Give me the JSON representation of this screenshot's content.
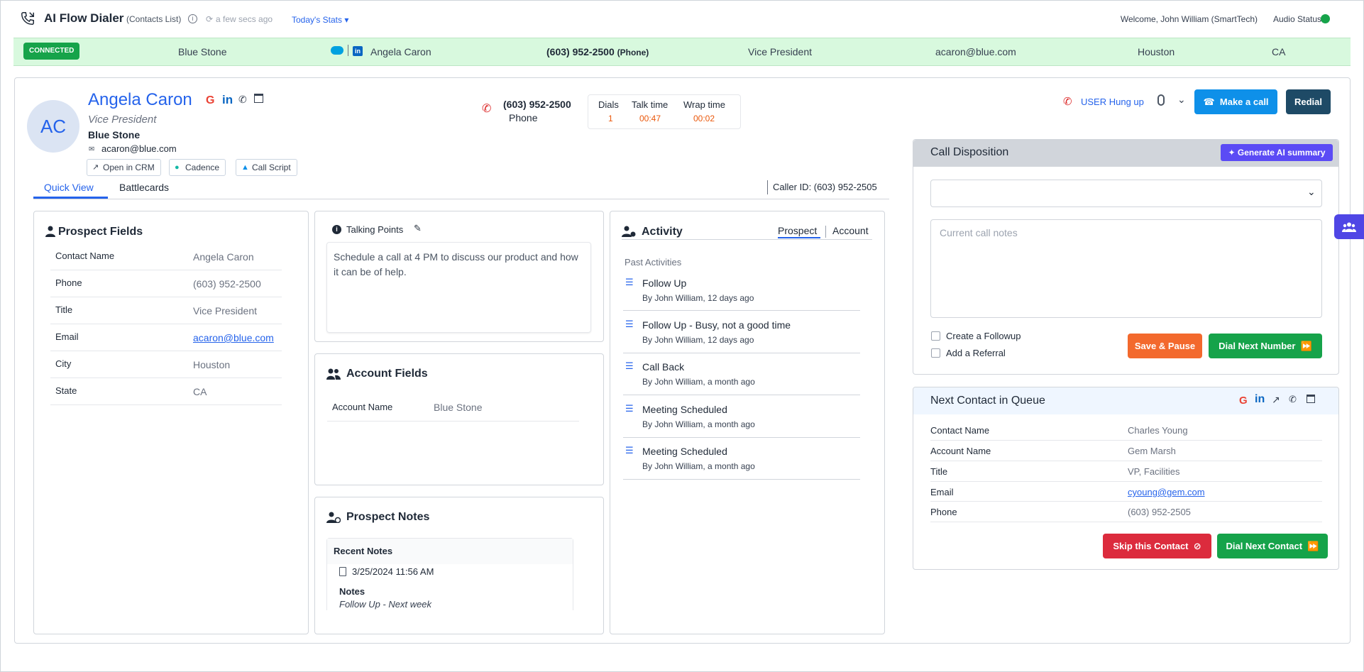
{
  "header": {
    "app_title": "AI Flow Dialer",
    "contacts_list": "(Contacts List)",
    "sync_text": "a few secs ago",
    "stats_link": "Today's Stats ▾",
    "welcome": "Welcome, John William (SmartTech)",
    "audio_status": "Audio Status"
  },
  "strip": {
    "badge": "CONNECTED",
    "company": "Blue Stone",
    "name": "Angela Caron",
    "phone": "(603) 952-2500",
    "phone_type": "(Phone)",
    "title": "Vice President",
    "email": "acaron@blue.com",
    "city": "Houston",
    "state": "CA"
  },
  "prospect": {
    "initials": "AC",
    "name": "Angela Caron",
    "title": "Vice President",
    "company": "Blue Stone",
    "email": "acaron@blue.com",
    "buttons": {
      "crm": "Open in CRM",
      "cadence": "Cadence",
      "script": "Call Script"
    }
  },
  "call": {
    "number": "(603) 952-2500",
    "type": "Phone",
    "stats": [
      {
        "label": "Dials",
        "value": "1"
      },
      {
        "label": "Talk time",
        "value": "00:47"
      },
      {
        "label": "Wrap time",
        "value": "00:02"
      }
    ],
    "status": "USER Hung up",
    "make_call": "Make a call",
    "redial": "Redial"
  },
  "tabs": {
    "quick_view": "Quick View",
    "battlecards": "Battlecards",
    "caller_id": "Caller ID: (603) 952-2505"
  },
  "prospect_fields": {
    "title": "Prospect Fields",
    "rows": [
      {
        "label": "Contact Name",
        "value": "Angela Caron"
      },
      {
        "label": "Phone",
        "value": "(603) 952-2500"
      },
      {
        "label": "Title",
        "value": "Vice President"
      },
      {
        "label": "Email",
        "value": "acaron@blue.com"
      },
      {
        "label": "City",
        "value": "Houston"
      },
      {
        "label": "State",
        "value": "CA"
      }
    ]
  },
  "talking_points": {
    "title": "Talking Points",
    "text": "Schedule a call at 4 PM to discuss our product and how it can be of help."
  },
  "account_fields": {
    "title": "Account Fields",
    "rows": [
      {
        "label": "Account Name",
        "value": "Blue Stone"
      }
    ]
  },
  "prospect_notes": {
    "title": "Prospect Notes",
    "recent": "Recent Notes",
    "date": "3/25/2024 11:56 AM",
    "notes_label": "Notes",
    "note": "Follow Up - Next week"
  },
  "activity": {
    "title": "Activity",
    "tab_prospect": "Prospect",
    "tab_account": "Account",
    "past": "Past Activities",
    "items": [
      {
        "title": "Follow Up",
        "sub": "By John William, 12 days ago"
      },
      {
        "title": "Follow Up - Busy, not a good time",
        "sub": "By John William, 12 days ago"
      },
      {
        "title": "Call Back",
        "sub": "By John William, a month ago"
      },
      {
        "title": "Meeting Scheduled",
        "sub": "By John William, a month ago"
      },
      {
        "title": "Meeting Scheduled",
        "sub": "By John William, a month ago"
      }
    ]
  },
  "disposition": {
    "title": "Call Disposition",
    "generate_ai": "Generate AI summary",
    "notes_placeholder": "Current call notes",
    "followup": "Create a Followup",
    "referral": "Add a Referral",
    "save_pause": "Save & Pause",
    "dial_next_number": "Dial Next Number"
  },
  "queue": {
    "title": "Next Contact in Queue",
    "rows": [
      {
        "label": "Contact Name",
        "value": "Charles Young"
      },
      {
        "label": "Account Name",
        "value": "Gem Marsh"
      },
      {
        "label": "Title",
        "value": "VP, Facilities"
      },
      {
        "label": "Email",
        "value": "cyoung@gem.com"
      },
      {
        "label": "Phone",
        "value": "(603) 952-2505"
      }
    ],
    "skip": "Skip this Contact",
    "dial_next_contact": "Dial Next Contact"
  }
}
